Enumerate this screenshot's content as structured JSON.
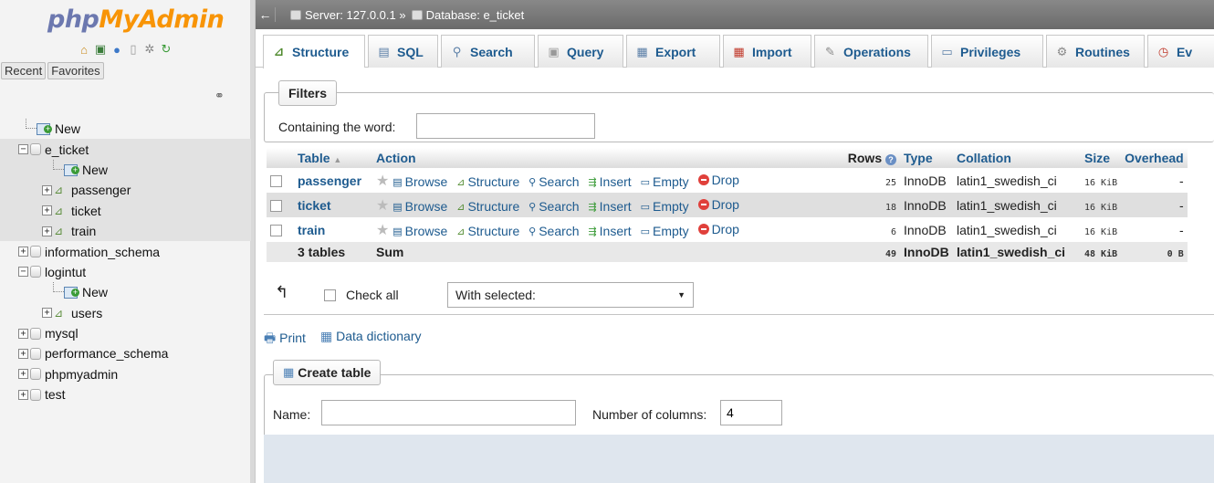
{
  "sidebar": {
    "logo_part1": "php",
    "logo_part2": "MyAdmin",
    "icons": [
      "home-icon",
      "exit-icon",
      "help-icon",
      "docs-icon",
      "settings-icon",
      "reload-icon"
    ],
    "tabs": [
      "Recent",
      "Favorites"
    ],
    "tree": [
      {
        "label": "New",
        "kind": "new",
        "indent": 1,
        "selected": false
      },
      {
        "label": "e_ticket",
        "kind": "db",
        "indent": 0,
        "expanded": true,
        "selected": true
      },
      {
        "label": "New",
        "kind": "new",
        "indent": 2,
        "selected": true
      },
      {
        "label": "passenger",
        "kind": "table",
        "indent": 2,
        "selected": true
      },
      {
        "label": "ticket",
        "kind": "table",
        "indent": 2,
        "selected": true
      },
      {
        "label": "train",
        "kind": "table",
        "indent": 2,
        "selected": true
      },
      {
        "label": "information_schema",
        "kind": "db",
        "indent": 0,
        "expanded": false,
        "selected": false
      },
      {
        "label": "logintut",
        "kind": "db",
        "indent": 0,
        "expanded": true,
        "selected": false
      },
      {
        "label": "New",
        "kind": "new",
        "indent": 2,
        "selected": false
      },
      {
        "label": "users",
        "kind": "table",
        "indent": 2,
        "selected": false
      },
      {
        "label": "mysql",
        "kind": "db",
        "indent": 0,
        "expanded": false,
        "selected": false
      },
      {
        "label": "performance_schema",
        "kind": "db",
        "indent": 0,
        "expanded": false,
        "selected": false
      },
      {
        "label": "phpmyadmin",
        "kind": "db",
        "indent": 0,
        "expanded": false,
        "selected": false
      },
      {
        "label": "test",
        "kind": "db",
        "indent": 0,
        "expanded": false,
        "selected": false
      }
    ]
  },
  "topbar": {
    "server_label": "Server: 127.0.0.1 »",
    "database_label": "Database: e_ticket"
  },
  "tabs": [
    {
      "label": "Structure",
      "icon": "structure-icon",
      "active": true
    },
    {
      "label": "SQL",
      "icon": "sql-icon",
      "active": false
    },
    {
      "label": "Search",
      "icon": "search-icon",
      "active": false
    },
    {
      "label": "Query",
      "icon": "query-icon",
      "active": false
    },
    {
      "label": "Export",
      "icon": "export-icon",
      "active": false
    },
    {
      "label": "Import",
      "icon": "import-icon",
      "active": false
    },
    {
      "label": "Operations",
      "icon": "wrench-icon",
      "active": false
    },
    {
      "label": "Privileges",
      "icon": "privileges-icon",
      "active": false
    },
    {
      "label": "Routines",
      "icon": "routines-icon",
      "active": false
    },
    {
      "label": "Ev",
      "icon": "clock-icon",
      "active": false
    }
  ],
  "filters": {
    "legend": "Filters",
    "label": "Containing the word:",
    "value": ""
  },
  "table": {
    "headers": {
      "table": "Table",
      "sort_arrow": "▲",
      "action": "Action",
      "rows": "Rows",
      "type": "Type",
      "collation": "Collation",
      "size": "Size",
      "overhead": "Overhead"
    },
    "actions": [
      "Browse",
      "Structure",
      "Search",
      "Insert",
      "Empty",
      "Drop"
    ],
    "rows": [
      {
        "name": "passenger",
        "rows": "25",
        "type": "InnoDB",
        "collation": "latin1_swedish_ci",
        "size": "16 KiB",
        "overhead": "-"
      },
      {
        "name": "ticket",
        "rows": "18",
        "type": "InnoDB",
        "collation": "latin1_swedish_ci",
        "size": "16 KiB",
        "overhead": "-"
      },
      {
        "name": "train",
        "rows": "6",
        "type": "InnoDB",
        "collation": "latin1_swedish_ci",
        "size": "16 KiB",
        "overhead": "-"
      }
    ],
    "summary": {
      "count": "3 tables",
      "label": "Sum",
      "rows": "49",
      "type": "InnoDB",
      "collation": "latin1_swedish_ci",
      "size": "48 KiB",
      "overhead": "0 B"
    }
  },
  "bulk": {
    "check_all": "Check all",
    "with_selected": "With selected:"
  },
  "links": {
    "print": "Print",
    "data_dictionary": "Data dictionary"
  },
  "create_table": {
    "legend": "Create table",
    "name_label": "Name:",
    "name_value": "",
    "columns_label": "Number of columns:",
    "columns_value": "4"
  }
}
